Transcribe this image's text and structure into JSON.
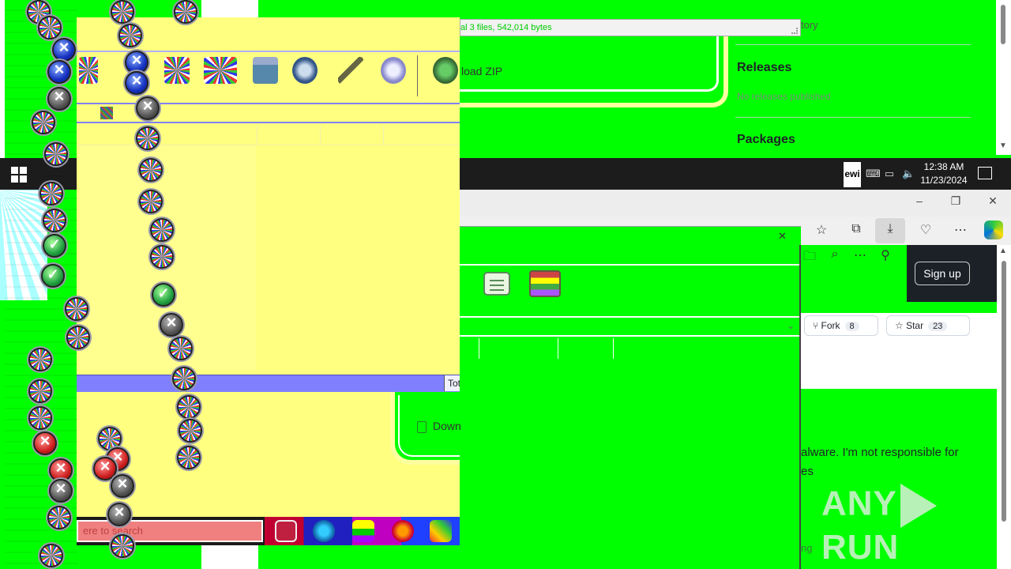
{
  "github": {
    "download_zip": "load ZIP",
    "about_tail": "tory",
    "releases_title": "Releases",
    "releases_note": "No releases published",
    "packages_title": "Packages",
    "sign_up": "Sign up",
    "fork_label": "Fork",
    "fork_count": "8",
    "star_label": "Star",
    "star_count": "23",
    "readme_line1": "alware. I'm not responsible for",
    "readme_line2": "es",
    "readme_line3": "ng"
  },
  "winrar": {
    "status_text": "al 3 files, 542,014 bytes",
    "total_label": "Tot",
    "download_bubble": "Down"
  },
  "search": {
    "placeholder": "ere to search"
  },
  "taskbar": {
    "tray_truncated": "ewi",
    "time": "12:38 AM",
    "date": "11/23/2024"
  },
  "watermark": {
    "left": "ANY",
    "right": "RUN"
  },
  "icons": {
    "start": "windows-logo-icon",
    "copilot": "copilot-icon",
    "downloads": "download-icon",
    "favorites": "star-plus-icon",
    "collections": "collections-icon",
    "health": "heart-pulse-icon",
    "more": "more-icon"
  },
  "colors": {
    "glitch_green": "#00ff00",
    "winrar_yellow": "#ffff80",
    "winrar_blue": "#8080ff",
    "taskbar": "#1c1c1c"
  }
}
